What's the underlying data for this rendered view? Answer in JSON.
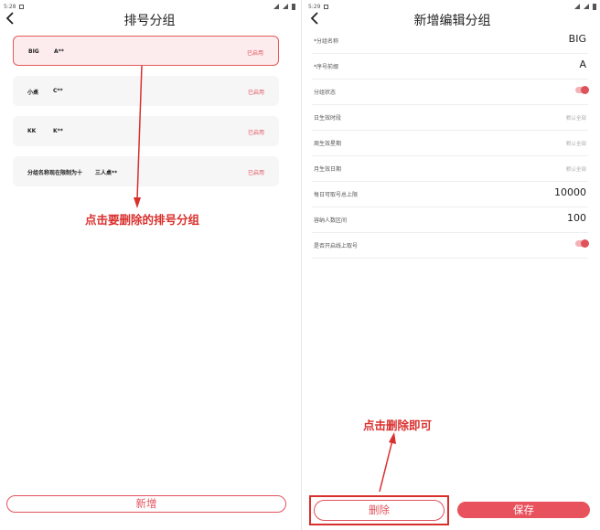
{
  "left": {
    "status": {
      "time": "5:28"
    },
    "title": "排号分组",
    "groups": [
      {
        "name": "BIG",
        "code": "A**",
        "status": "已启用"
      },
      {
        "name": "小桌",
        "code": "C**",
        "status": "已启用"
      },
      {
        "name": "KK",
        "code": "K**",
        "status": "已启用"
      },
      {
        "name": "分组名称现在限制为十",
        "code": "三人桌**",
        "status": "已启用"
      }
    ],
    "annotation": "点击要删除的排号分组",
    "add_button": "新增"
  },
  "right": {
    "status": {
      "time": "5:29"
    },
    "title": "新增编辑分组",
    "fields": [
      {
        "label": "*分组名称",
        "value": "BIG"
      },
      {
        "label": "*序号前缀",
        "value": "A"
      },
      {
        "label": "分组状态",
        "toggle": true
      },
      {
        "label": "日生效时段",
        "placeholder": "默认全部"
      },
      {
        "label": "周生效星期",
        "placeholder": "默认全部"
      },
      {
        "label": "月生效日期",
        "placeholder": "默认全部"
      },
      {
        "label": "每日可取号总上限",
        "value": "10000"
      },
      {
        "label": "容纳人数区间",
        "value": "100"
      },
      {
        "label": "是否开启线上取号",
        "toggle": true
      }
    ],
    "annotation": "点击删除即可",
    "delete_button": "删除",
    "save_button": "保存"
  },
  "colors": {
    "accent": "#e0525b",
    "annotation": "#d9302e"
  }
}
